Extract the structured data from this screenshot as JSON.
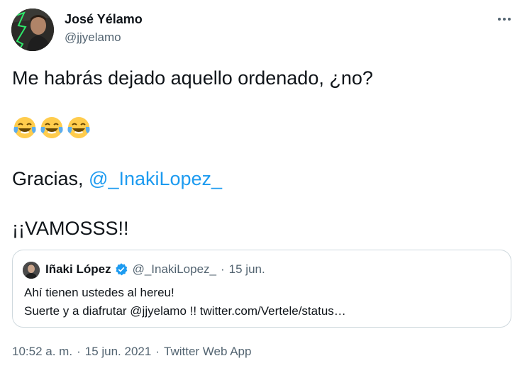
{
  "author": {
    "name": "José Yélamo",
    "handle": "@jjyelamo"
  },
  "tweet": {
    "line1": "Me habrás dejado aquello ordenado, ¿no?",
    "emojis": [
      "face-with-tears-of-joy",
      "face-with-tears-of-joy",
      "face-with-tears-of-joy"
    ],
    "line3_prefix": "Gracias, ",
    "line3_mention": "@_InakiLopez_",
    "line4": "¡¡VAMOSSS!!"
  },
  "quote": {
    "name": "Iñaki López",
    "verified": true,
    "handle": "@_InakiLopez_",
    "dot": "·",
    "date": "15 jun.",
    "text_line1": "Ahí tienen ustedes al hereu!",
    "text_line2": "Suerte y a diafrutar @jjyelamo !! twitter.com/Vertele/status…"
  },
  "meta": {
    "time": "10:52 a. m.",
    "date": "15 jun. 2021",
    "source": "Twitter Web App",
    "separator": "·"
  },
  "icons": {
    "more": "more-horizontal-icon",
    "verified": "verified-badge-icon"
  },
  "colors": {
    "accent": "#1d9bf0",
    "secondary_text": "#536471",
    "border": "#cfd9de"
  }
}
